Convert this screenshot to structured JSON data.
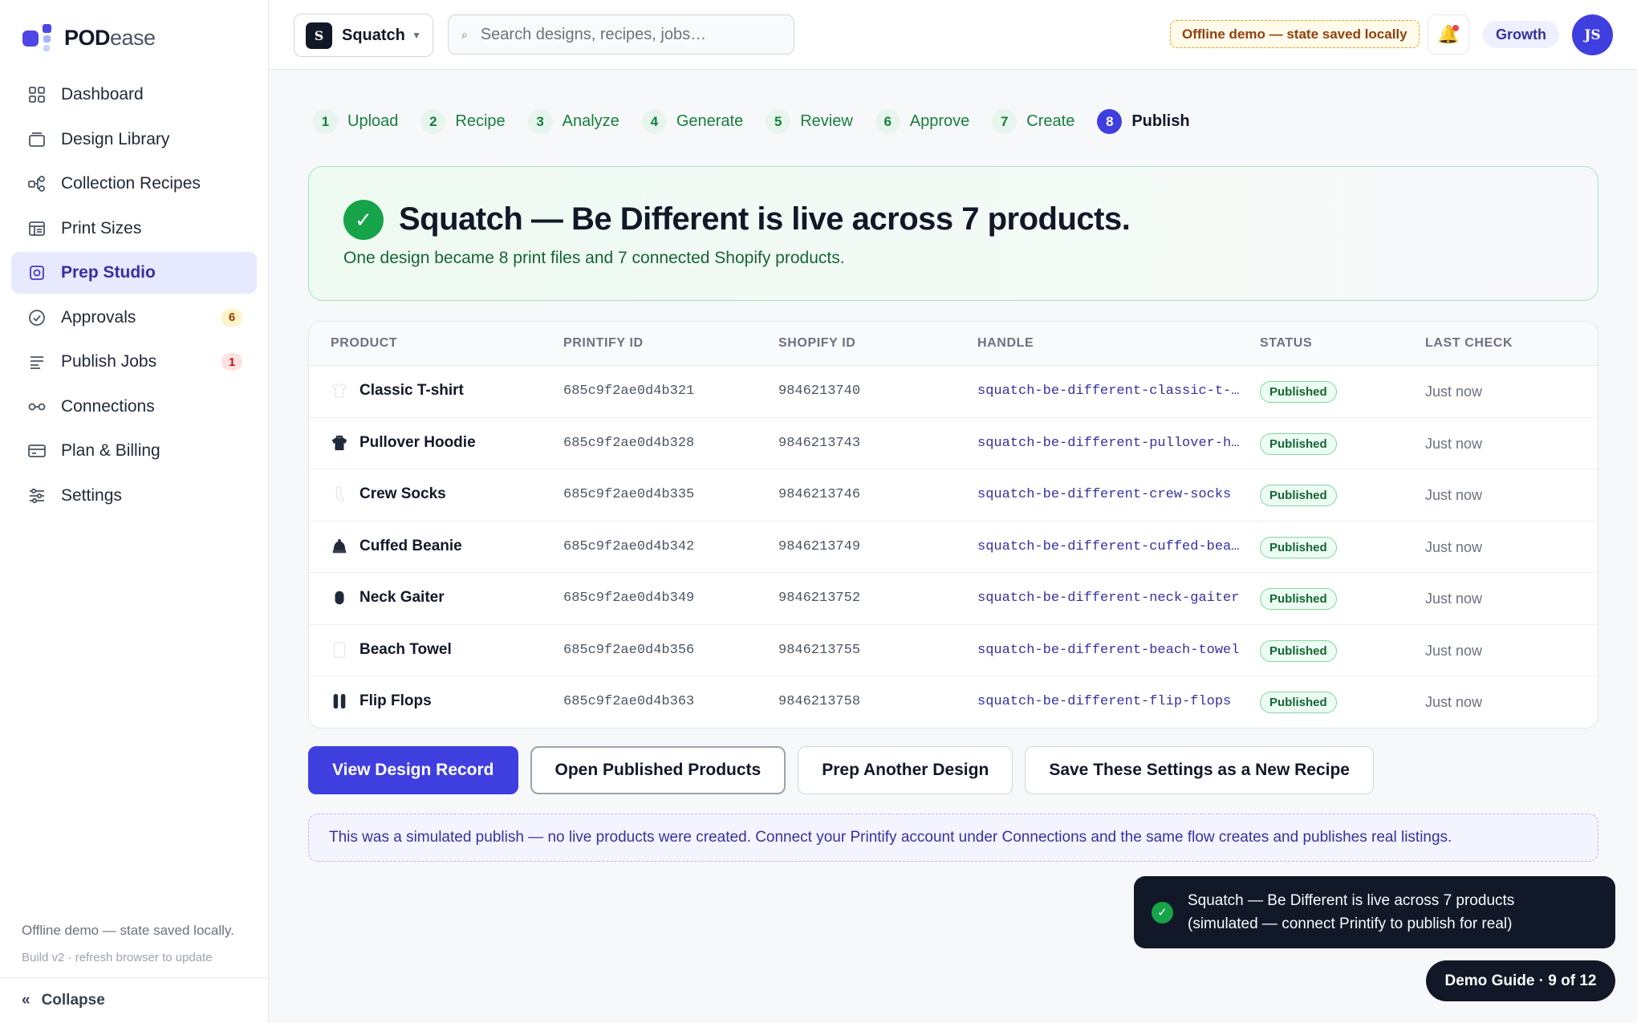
{
  "brand": {
    "name_bold": "POD",
    "name_light": "ease"
  },
  "sidebar": {
    "items": [
      {
        "label": "Dashboard",
        "icon": "dashboard-icon"
      },
      {
        "label": "Design Library",
        "icon": "library-icon"
      },
      {
        "label": "Collection Recipes",
        "icon": "recipes-icon"
      },
      {
        "label": "Print Sizes",
        "icon": "print-sizes-icon"
      },
      {
        "label": "Prep Studio",
        "icon": "prep-studio-icon",
        "active": true
      },
      {
        "label": "Approvals",
        "icon": "approvals-icon",
        "badge": "6"
      },
      {
        "label": "Publish Jobs",
        "icon": "publish-jobs-icon",
        "badge": "1"
      },
      {
        "label": "Connections",
        "icon": "connections-icon"
      },
      {
        "label": "Plan & Billing",
        "icon": "billing-icon"
      },
      {
        "label": "Settings",
        "icon": "settings-icon"
      }
    ],
    "footer_status": "Offline demo — state saved locally.",
    "footer_build": "Build v2 · refresh browser to update",
    "collapse_icon": "«",
    "collapse_label": "Collapse"
  },
  "topbar": {
    "workspace_initial": "S",
    "workspace_name": "Squatch",
    "search_placeholder": "Search designs, recipes, jobs…",
    "offline_label": "Offline demo — state saved locally",
    "plan_label": "Growth",
    "user_initials": "JS"
  },
  "steps": [
    {
      "num": "1",
      "label": "Upload"
    },
    {
      "num": "2",
      "label": "Recipe"
    },
    {
      "num": "3",
      "label": "Analyze"
    },
    {
      "num": "4",
      "label": "Generate"
    },
    {
      "num": "5",
      "label": "Review"
    },
    {
      "num": "6",
      "label": "Approve"
    },
    {
      "num": "7",
      "label": "Create"
    },
    {
      "num": "8",
      "label": "Publish",
      "current": true
    }
  ],
  "banner": {
    "title": "Squatch — Be Different is live across 7 products.",
    "subtitle": "One design became 8 print files and 7 connected Shopify products."
  },
  "table": {
    "headers": [
      "PRODUCT",
      "PRINTIFY ID",
      "SHOPIFY ID",
      "HANDLE",
      "STATUS",
      "LAST CHECK"
    ],
    "rows": [
      {
        "product": "Classic T-shirt",
        "icon": "tshirt-icon",
        "printify_id": "685c9f2ae0d4b321",
        "shopify_id": "9846213740",
        "handle": "squatch-be-different-classic-t-shirt",
        "status": "Published",
        "last_check": "Just now"
      },
      {
        "product": "Pullover Hoodie",
        "icon": "hoodie-icon",
        "printify_id": "685c9f2ae0d4b328",
        "shopify_id": "9846213743",
        "handle": "squatch-be-different-pullover-hoodie",
        "status": "Published",
        "last_check": "Just now"
      },
      {
        "product": "Crew Socks",
        "icon": "socks-icon",
        "printify_id": "685c9f2ae0d4b335",
        "shopify_id": "9846213746",
        "handle": "squatch-be-different-crew-socks",
        "status": "Published",
        "last_check": "Just now"
      },
      {
        "product": "Cuffed Beanie",
        "icon": "beanie-icon",
        "printify_id": "685c9f2ae0d4b342",
        "shopify_id": "9846213749",
        "handle": "squatch-be-different-cuffed-beanie",
        "status": "Published",
        "last_check": "Just now"
      },
      {
        "product": "Neck Gaiter",
        "icon": "gaiter-icon",
        "printify_id": "685c9f2ae0d4b349",
        "shopify_id": "9846213752",
        "handle": "squatch-be-different-neck-gaiter",
        "status": "Published",
        "last_check": "Just now"
      },
      {
        "product": "Beach Towel",
        "icon": "towel-icon",
        "printify_id": "685c9f2ae0d4b356",
        "shopify_id": "9846213755",
        "handle": "squatch-be-different-beach-towel",
        "status": "Published",
        "last_check": "Just now"
      },
      {
        "product": "Flip Flops",
        "icon": "flip-flops-icon",
        "printify_id": "685c9f2ae0d4b363",
        "shopify_id": "9846213758",
        "handle": "squatch-be-different-flip-flops",
        "status": "Published",
        "last_check": "Just now"
      }
    ]
  },
  "actions": {
    "view_record": "View Design Record",
    "open_published": "Open Published Products",
    "prep_another": "Prep Another Design",
    "save_recipe": "Save These Settings as a New Recipe"
  },
  "notice": "This was a simulated publish — no live products were created. Connect your Printify account under Connections and the same flow creates and publishes real listings.",
  "toast": {
    "line1": "Squatch — Be Different is live across 7 products",
    "line2": "(simulated — connect Printify to publish for real)"
  },
  "demo_guide": "Demo Guide · 9 of 12",
  "colors": {
    "accent": "#3f3fe0",
    "success": "#16a34a",
    "active_nav_bg": "#e7eaff"
  }
}
